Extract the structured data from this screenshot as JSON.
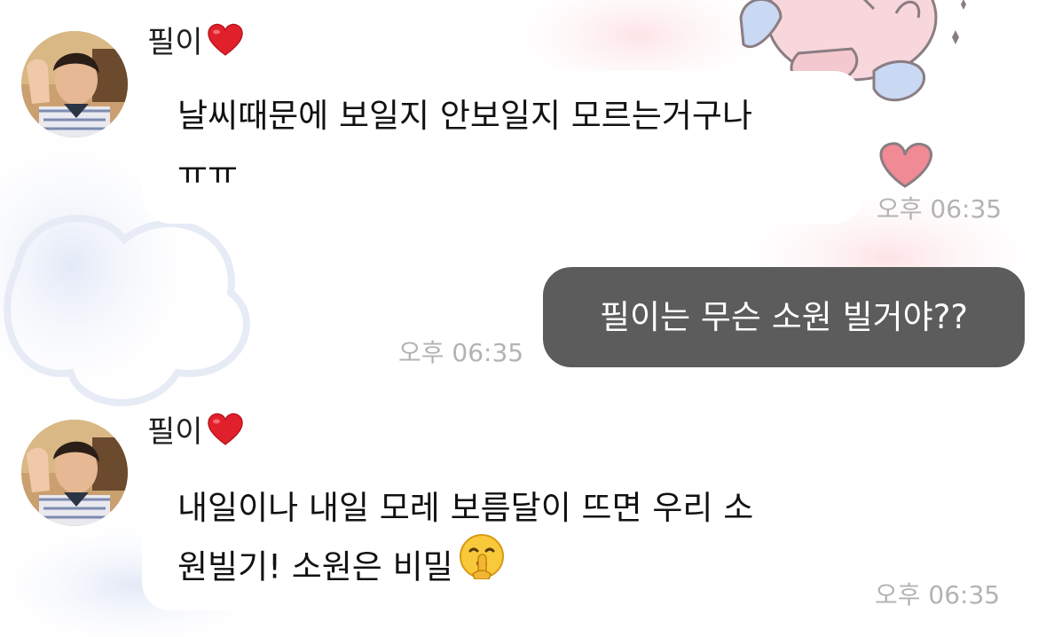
{
  "messages": [
    {
      "sender": "필이",
      "sender_icon": "red-heart",
      "lines": [
        "날씨때문에 보일지 안보일지 모르는거구나",
        "ㅠㅠ"
      ],
      "time": "오후 06:35"
    },
    {
      "outgoing": true,
      "text": "필이는 무슨 소원 빌거야??",
      "time": "오후 06:35"
    },
    {
      "sender": "필이",
      "sender_icon": "red-heart",
      "lines": [
        "내일이나 내일 모레 보름달이 뜨면 우리 소",
        "원빌기! 소원은 비밀"
      ],
      "trailing_emoji": "shushing-face",
      "time": "오후 06:35"
    }
  ],
  "colors": {
    "outgoing_bubble": "#5c5c5c",
    "incoming_bubble": "#ffffff",
    "timestamp": "#b3b3b3",
    "heart": "#e0202a"
  }
}
